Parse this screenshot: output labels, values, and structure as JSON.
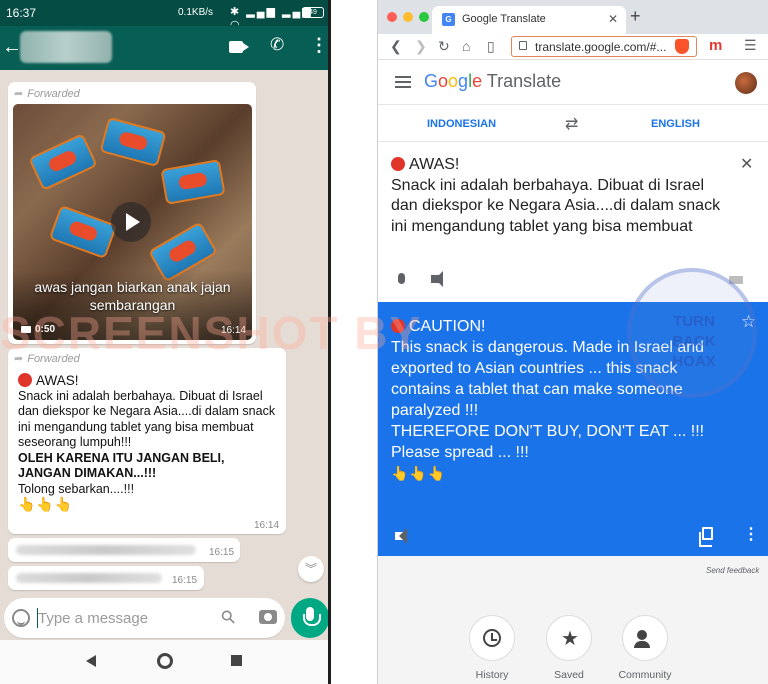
{
  "phone": {
    "status": {
      "time": "16:37",
      "speed": "0.1KB/s",
      "icons": "✱ ▂▄▆ ▂▄▆ ◠",
      "battery": "49"
    },
    "header": {
      "back_icon": "arrow-left-icon",
      "video_icon": "videocam-icon",
      "call_icon": "phone-icon",
      "menu_icon": "more-vert-icon"
    },
    "video_message": {
      "forwarded_label": "Forwarded",
      "caption": "awas jangan biarkan anak jajan sembarangan",
      "duration": "0:50",
      "time": "16:14"
    },
    "text_message": {
      "forwarded_label": "Forwarded",
      "title": "AWAS!",
      "body": "Snack ini adalah berbahaya. Dibuat di Israel dan diekspor ke Negara Asia....di dalam snack ini mengandung tablet yang bisa membuat seseorang lumpuh!!!",
      "bold": "OLEH KARENA ITU JANGAN BELI, JANGAN DIMAKAN...!!!",
      "closing": "Tolong sebarkan....!!!",
      "emoji": "👆👆👆",
      "time": "16:14"
    },
    "blurred_messages": [
      {
        "time": "16:15"
      },
      {
        "time": "16:15"
      }
    ],
    "input": {
      "placeholder": "Type a message"
    }
  },
  "browser": {
    "tab_title": "Google Translate",
    "tab_close": "✕",
    "new_tab": "+",
    "url": "translate.google.com/#...",
    "brave_badge": "10",
    "extension_letter": "m",
    "app_name": "Google Translate",
    "logo_letters": [
      "G",
      "o",
      "o",
      "g",
      "l",
      "e"
    ],
    "logo_suffix": "Translate",
    "source_lang": "INDONESIAN",
    "target_lang": "ENGLISH",
    "source": {
      "title": "AWAS!",
      "text": "Snack ini adalah berbahaya. Dibuat di Israel dan diekspor ke Negara Asia....di dalam snack ini mengandung tablet yang bisa membuat"
    },
    "translation": {
      "title": "CAUTION!",
      "text": "This snack is dangerous. Made in Israel and exported to Asian countries ... this snack contains a tablet that can make someone paralyzed !!!",
      "caps": "THEREFORE DON'T BUY, DON'T EAT ... !!!",
      "closing": "Please spread ... !!!",
      "emoji": "👆👆👆"
    },
    "send_feedback": "Send feedback",
    "bottom_buttons": [
      {
        "label": "History",
        "icon": "history-icon"
      },
      {
        "label": "Saved",
        "icon": "star-icon"
      },
      {
        "label": "Community",
        "icon": "community-icon"
      }
    ]
  },
  "watermark": {
    "text": "SCREENSHOT BY",
    "seal_text": "TURN BACK HOAX"
  },
  "colors": {
    "wa_header": "#075e54",
    "wa_status": "#054d44",
    "wa_bg": "#e5ddd5",
    "wa_mic": "#00a884",
    "gt_blue": "#1a73e8"
  }
}
